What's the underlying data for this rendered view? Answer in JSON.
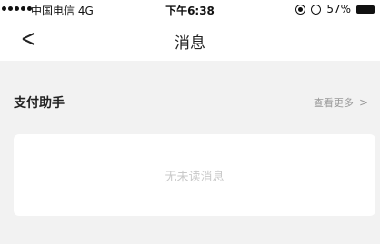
{
  "status_bar": {
    "carrier": "中国电信  4G",
    "time": "下午6:38",
    "battery": "57%"
  },
  "nav": {
    "back_symbol": "<",
    "title": "消息"
  },
  "section": {
    "title": "支付助手",
    "see_more": "查看更多",
    "see_more_chevron": ">"
  },
  "card": {
    "empty_text": "无未读消息"
  }
}
